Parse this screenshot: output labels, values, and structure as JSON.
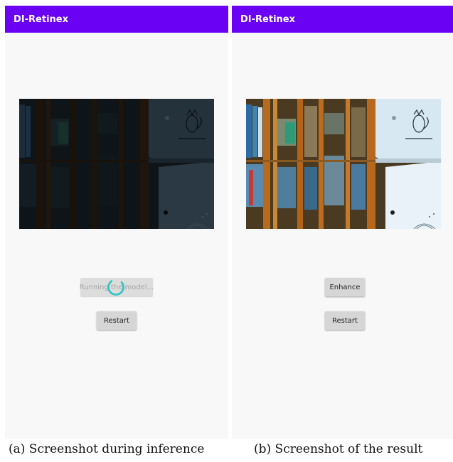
{
  "panels": [
    {
      "app_title": "DI-Retinex",
      "buttons": {
        "primary_label": "Running the model...",
        "secondary_label": "Restart"
      },
      "caption": "(a) Screenshot during inference"
    },
    {
      "app_title": "DI-Retinex",
      "buttons": {
        "primary_label": "Enhance",
        "secondary_label": "Restart"
      },
      "caption": "(b) Screenshot of the result"
    }
  ],
  "colors": {
    "appbar": "#6a00f4",
    "spinner": "#2ec4c4",
    "background": "#f8f8f8"
  },
  "icons": {
    "spinner": "progress-spinner-icon"
  }
}
